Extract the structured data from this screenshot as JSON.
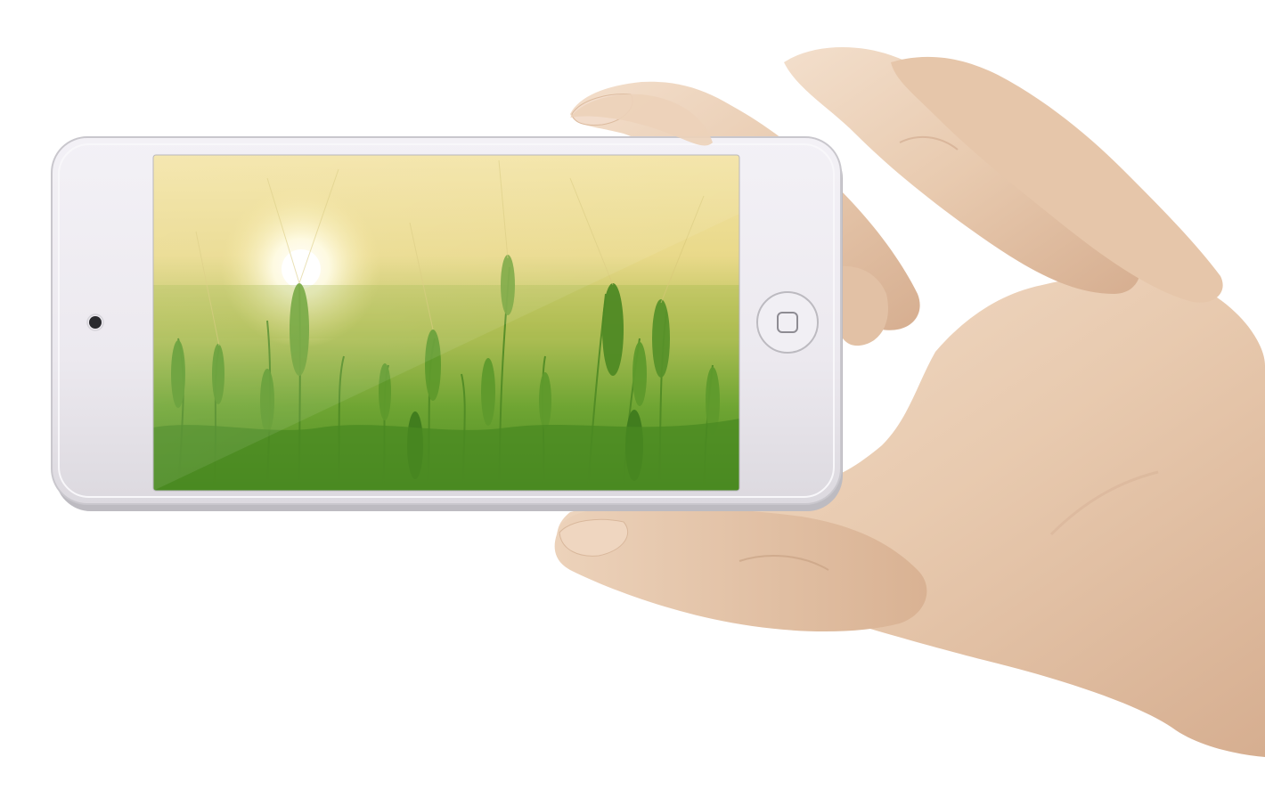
{
  "scene": {
    "description_icon": "hand-holding-phone",
    "subject": "phone-photo",
    "screen_content": "wheat-field-sunrise"
  },
  "colors": {
    "background": "#ffffff",
    "phone_body": "#efedf2",
    "phone_rim": "#c9c7cd",
    "skin_light": "#f0d9c4",
    "skin_mid": "#e3c2a6",
    "skin_shadow": "#c9a184",
    "sky_top": "#f4e6a8",
    "field_green": "#5d9a2c",
    "field_dark": "#3d7a1e",
    "sun": "#ffffff"
  }
}
